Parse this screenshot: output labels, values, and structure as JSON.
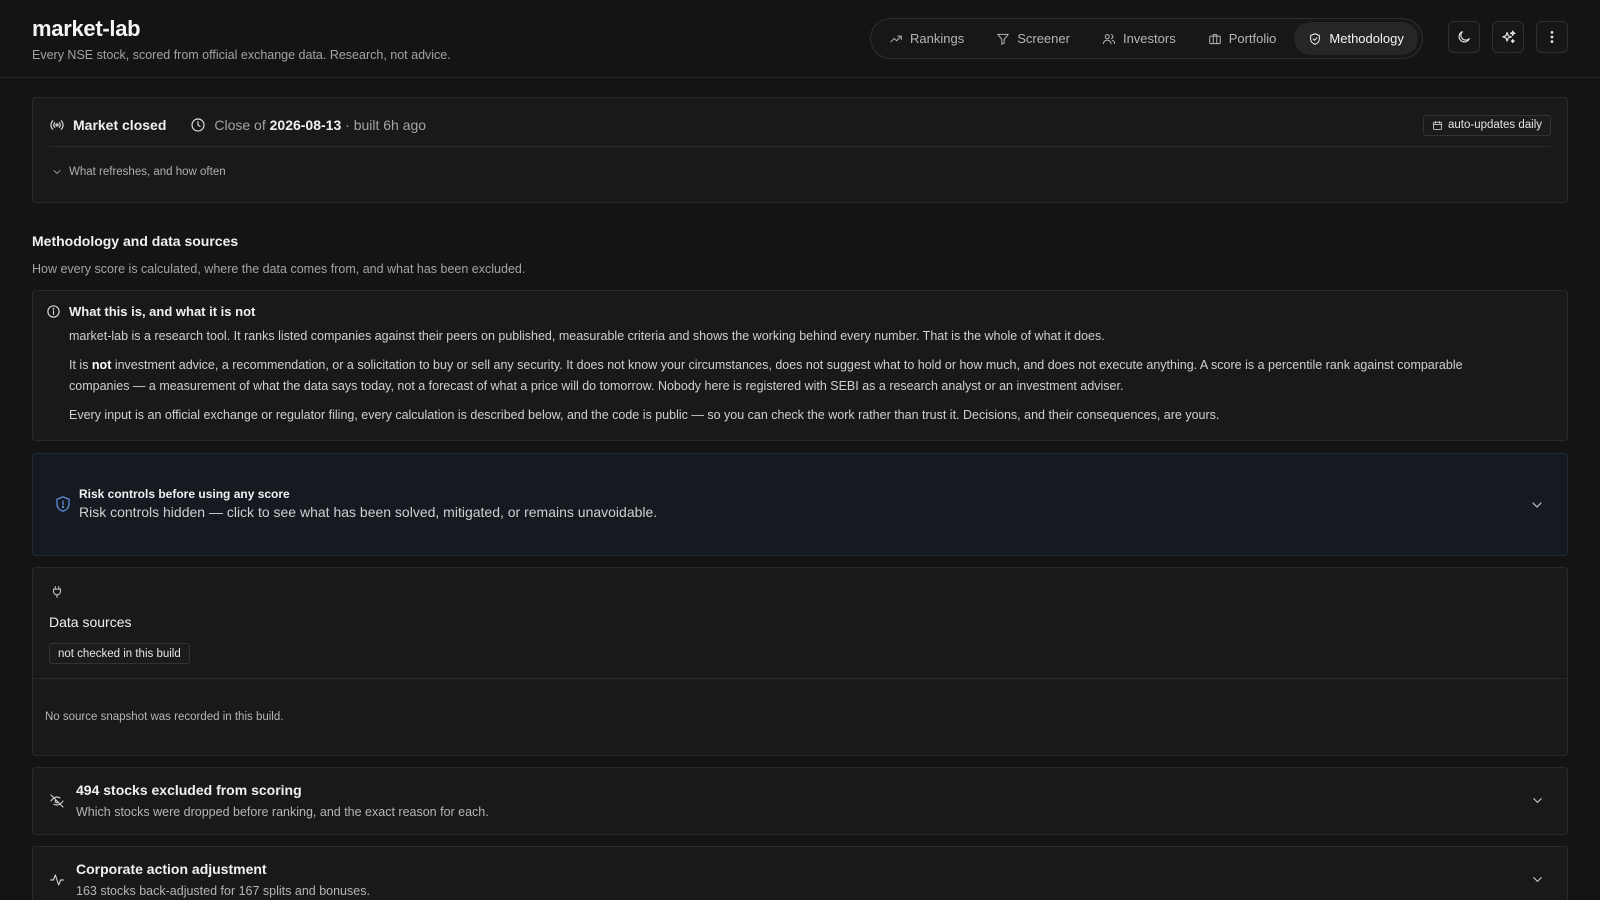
{
  "app": {
    "title": "market-lab",
    "subtitle": "Every NSE stock, scored from official exchange data. Research, not advice."
  },
  "nav": {
    "items": [
      {
        "label": "Rankings",
        "icon": "trending-up-icon"
      },
      {
        "label": "Screener",
        "icon": "filter-icon"
      },
      {
        "label": "Investors",
        "icon": "users-icon"
      },
      {
        "label": "Portfolio",
        "icon": "briefcase-icon"
      },
      {
        "label": "Methodology",
        "icon": "shield-icon",
        "active": true
      }
    ],
    "actions": [
      "theme-toggle",
      "sparkles",
      "more-menu"
    ]
  },
  "status": {
    "market_state": "Market closed",
    "close_prefix": "Close of ",
    "close_date": "2026-08-13",
    "close_suffix": " · built 6h ago",
    "badge": "auto-updates daily",
    "refresh_toggle": "What refreshes, and how often"
  },
  "methodology": {
    "title": "Methodology and data sources",
    "description": "How every score is calculated, where the data comes from, and what has been excluded."
  },
  "disclaimer": {
    "title": "What this is, and what it is not",
    "p1": "market-lab is a research tool. It ranks listed companies against their peers on published, measurable criteria and shows the working behind every number. That is the whole of what it does.",
    "p2_before": "It is ",
    "p2_bold": "not",
    "p2_after": " investment advice, a recommendation, or a solicitation to buy or sell any security. It does not know your circumstances, does not suggest what to hold or how much, and does not execute anything. A score is a percentile rank against comparable companies — a measurement of what the data says today, not a forecast of what a price will do tomorrow. Nobody here is registered with SEBI as a research analyst or an investment adviser.",
    "p3": "Every input is an official exchange or regulator filing, every calculation is described below, and the code is public — so you can check the work rather than trust it. Decisions, and their consequences, are yours."
  },
  "risk": {
    "title": "Risk controls before using any score",
    "text": "Risk controls hidden — click to see what has been solved, mitigated, or remains unavoidable."
  },
  "data_sources": {
    "title": "Data sources",
    "badge": "not checked in this build",
    "empty": "No source snapshot was recorded in this build."
  },
  "excluded": {
    "title": "494 stocks excluded from scoring",
    "description": "Which stocks were dropped before ranking, and the exact reason for each."
  },
  "corporate": {
    "title": "Corporate action adjustment",
    "description": "163 stocks back-adjusted for 167 splits and bonuses."
  },
  "colors": {
    "background": "#141414",
    "card": "#191919",
    "risk_card": "#151a20",
    "accent_blue": "#5b8fd9"
  }
}
